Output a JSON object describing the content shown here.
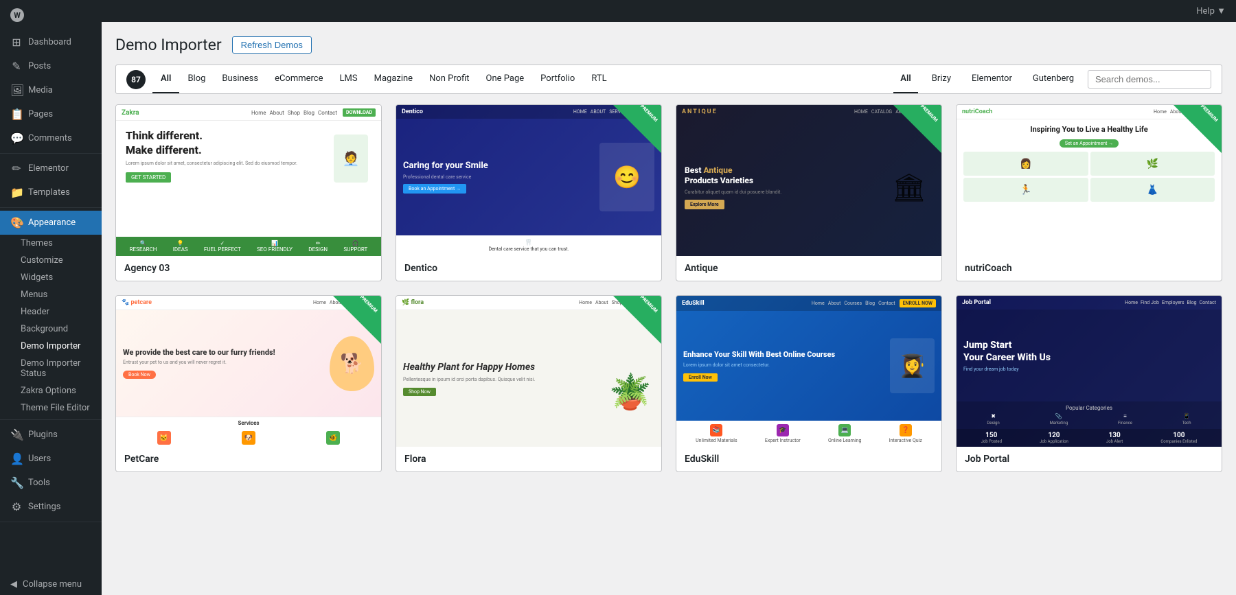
{
  "sidebar": {
    "logo": "W",
    "items": [
      {
        "id": "dashboard",
        "label": "Dashboard",
        "icon": "⊞"
      },
      {
        "id": "posts",
        "label": "Posts",
        "icon": "📄"
      },
      {
        "id": "media",
        "label": "Media",
        "icon": "🖼"
      },
      {
        "id": "pages",
        "label": "Pages",
        "icon": "📋"
      },
      {
        "id": "comments",
        "label": "Comments",
        "icon": "💬"
      },
      {
        "id": "elementor",
        "label": "Elementor",
        "icon": "✏"
      },
      {
        "id": "templates",
        "label": "Templates",
        "icon": "📁"
      },
      {
        "id": "appearance",
        "label": "Appearance",
        "icon": "🎨"
      },
      {
        "id": "plugins",
        "label": "Plugins",
        "icon": "🔌"
      },
      {
        "id": "users",
        "label": "Users",
        "icon": "👤"
      },
      {
        "id": "tools",
        "label": "Tools",
        "icon": "🔧"
      },
      {
        "id": "settings",
        "label": "Settings",
        "icon": "⚙"
      }
    ],
    "appearance_sub": [
      {
        "id": "themes",
        "label": "Themes"
      },
      {
        "id": "customize",
        "label": "Customize"
      },
      {
        "id": "widgets",
        "label": "Widgets"
      },
      {
        "id": "menus",
        "label": "Menus"
      },
      {
        "id": "header",
        "label": "Header"
      },
      {
        "id": "background",
        "label": "Background"
      },
      {
        "id": "demo-importer",
        "label": "Demo Importer"
      },
      {
        "id": "demo-importer-status",
        "label": "Demo Importer Status"
      },
      {
        "id": "zakra-options",
        "label": "Zakra Options"
      },
      {
        "id": "theme-file-editor",
        "label": "Theme File Editor"
      }
    ],
    "collapse": "Collapse menu"
  },
  "topbar": {
    "help_label": "Help ▼"
  },
  "page": {
    "title": "Demo Importer",
    "refresh_btn": "Refresh Demos"
  },
  "filter": {
    "count": "87",
    "tabs": [
      {
        "id": "all",
        "label": "All",
        "active": true
      },
      {
        "id": "blog",
        "label": "Blog"
      },
      {
        "id": "business",
        "label": "Business"
      },
      {
        "id": "ecommerce",
        "label": "eCommerce"
      },
      {
        "id": "lms",
        "label": "LMS"
      },
      {
        "id": "magazine",
        "label": "Magazine"
      },
      {
        "id": "nonprofit",
        "label": "Non Profit"
      },
      {
        "id": "one-page",
        "label": "One Page"
      },
      {
        "id": "portfolio",
        "label": "Portfolio"
      },
      {
        "id": "rtl",
        "label": "RTL"
      }
    ],
    "builder_tabs": [
      {
        "id": "all",
        "label": "All",
        "active": true
      },
      {
        "id": "brizy",
        "label": "Brizy"
      },
      {
        "id": "elementor",
        "label": "Elementor"
      },
      {
        "id": "gutenberg",
        "label": "Gutenberg"
      }
    ],
    "search_placeholder": "Search demos..."
  },
  "demos": [
    {
      "id": "agency03",
      "label": "Agency 03",
      "premium": false,
      "theme": "light",
      "tagline": "Think different. Make different.",
      "has_download": true
    },
    {
      "id": "dentico",
      "label": "Dentico",
      "premium": true,
      "theme": "dark-blue",
      "tagline": "Caring for your Smile"
    },
    {
      "id": "antique",
      "label": "Antique",
      "premium": true,
      "theme": "dark",
      "tagline": "Best Antique Products Varieties"
    },
    {
      "id": "nutricoach",
      "label": "nutriCoach",
      "premium": true,
      "theme": "light-green",
      "tagline": "Inspiring You to Live a Healthy Life"
    },
    {
      "id": "petcare",
      "label": "PetCare",
      "premium": true,
      "theme": "light-warm",
      "tagline": "We provide the best care to our furry friends!"
    },
    {
      "id": "flora",
      "label": "Flora",
      "premium": true,
      "theme": "light",
      "tagline": "Healthy Plant for Happy Homes"
    },
    {
      "id": "eduskill",
      "label": "EduSkill",
      "premium": false,
      "theme": "dark-blue",
      "tagline": "Enhance Your Skill With Best Online Courses"
    },
    {
      "id": "jobportal",
      "label": "Job Portal",
      "premium": false,
      "theme": "dark",
      "tagline": "Jump Start Your Career With Us"
    }
  ]
}
